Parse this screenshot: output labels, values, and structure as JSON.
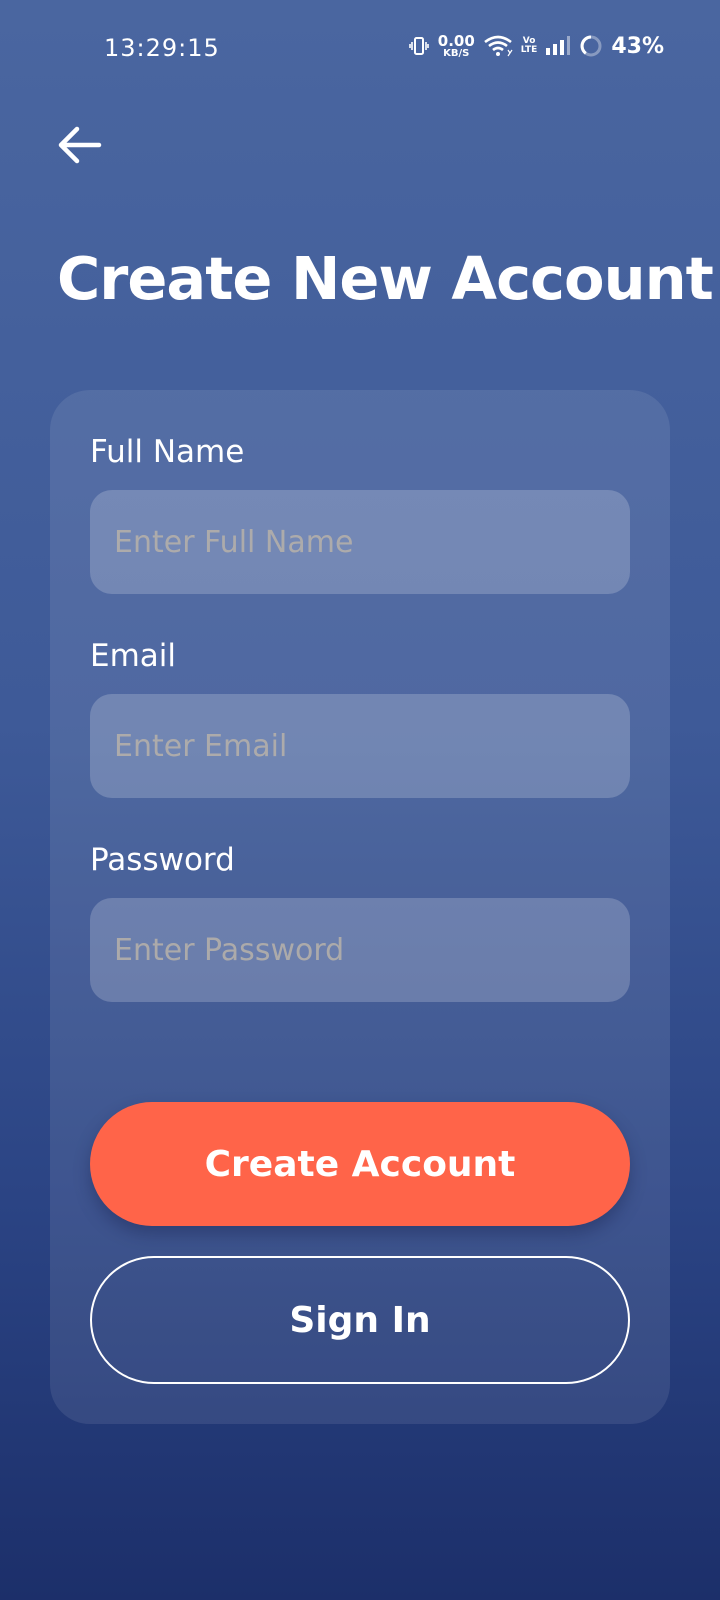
{
  "status_bar": {
    "time": "13:29:15",
    "net_speed_value": "0.00",
    "net_speed_unit": "KB/S",
    "volte_top": "Vo",
    "volte_bottom": "LTE",
    "battery": "43%",
    "icons": [
      "vibrate-icon",
      "wifi-icon",
      "signal-icon",
      "battery-icon"
    ]
  },
  "header": {
    "back_icon": "arrow-left-icon",
    "title": "Create New Account"
  },
  "form": {
    "full_name": {
      "label": "Full Name",
      "placeholder": "Enter Full Name",
      "value": ""
    },
    "email": {
      "label": "Email",
      "placeholder": "Enter Email",
      "value": ""
    },
    "password": {
      "label": "Password",
      "placeholder": "Enter Password",
      "value": ""
    }
  },
  "actions": {
    "create_account_label": "Create Account",
    "sign_in_label": "Sign In"
  },
  "colors": {
    "background_top": "#4a66a0",
    "background_bottom": "#1c2f6a",
    "primary_button": "#ff6449",
    "text": "#ffffff"
  }
}
